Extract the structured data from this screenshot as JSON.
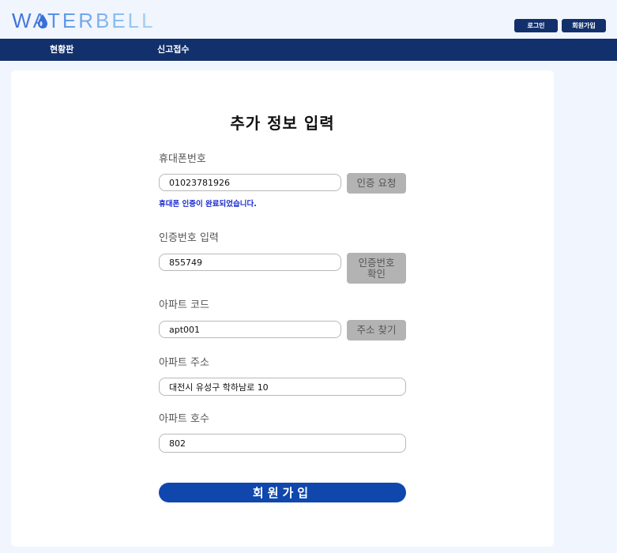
{
  "header": {
    "logo_text": "WATERBELL",
    "login_label": "로그인",
    "signup_label": "회원가입"
  },
  "nav": {
    "items": [
      "현황판",
      "신고접수"
    ]
  },
  "form": {
    "title": "추가 정보 입력",
    "phone": {
      "label": "휴대폰번호",
      "value": "01023781926",
      "button": "인증 요청",
      "status": "휴대폰 인증이 완료되었습니다."
    },
    "verify": {
      "label": "인증번호 입력",
      "value": "855749",
      "button_line1": "인증번호",
      "button_line2": "확인"
    },
    "apt_code": {
      "label": "아파트 코드",
      "value": "apt001",
      "button": "주소 찾기"
    },
    "apt_address": {
      "label": "아파트 주소",
      "value": "대전시 유성구 학하남로 10"
    },
    "apt_unit": {
      "label": "아파트 호수",
      "value": "802"
    },
    "submit_label": "회원가입"
  },
  "colors": {
    "nav_bg": "#12306b",
    "submit_bg": "#0f47ad",
    "status_text": "#1a2bd0",
    "page_bg": "#f1f5fd"
  },
  "icons": [
    "water-drop-icon"
  ]
}
